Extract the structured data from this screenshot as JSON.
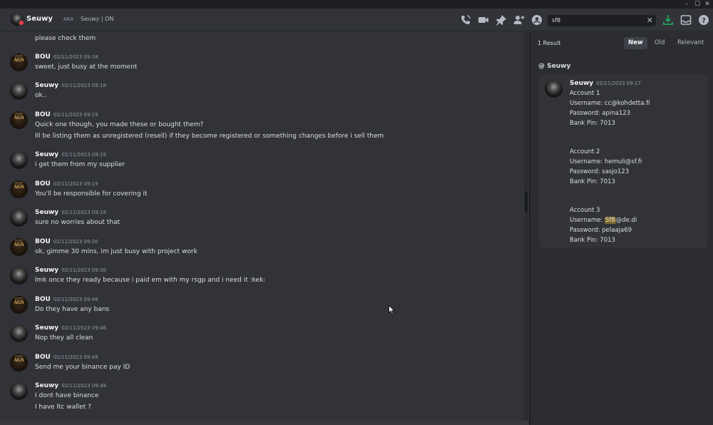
{
  "window": {
    "controls": [
      "–",
      "☐",
      "✕"
    ]
  },
  "header": {
    "name": "Seuwy",
    "aka_label": "AKA",
    "aka_value": "Seuwy | ON",
    "icons": [
      "phone-icon",
      "video-icon",
      "pin-icon",
      "add-friend-icon",
      "profile-icon",
      "download-icon",
      "inbox-icon",
      "help-icon"
    ],
    "search": {
      "value": "sf8",
      "placeholder": "Search"
    }
  },
  "chat": {
    "partial_top_line": "please check them",
    "messages": [
      {
        "author": "BOU",
        "time": "02/11/2023 09:18",
        "lines": [
          "sweet, just busy at the moment"
        ]
      },
      {
        "author": "Seuwy",
        "time": "02/11/2023 09:18",
        "lines": [
          "ok.."
        ]
      },
      {
        "author": "BOU",
        "time": "02/11/2023 09:19",
        "lines": [
          "Quick one though, you made these or bought them?",
          "Ill be listing them as unregistered (resell) if they become registered or something changes before i sell them"
        ]
      },
      {
        "author": "Seuwy",
        "time": "02/11/2023 09:19",
        "lines": [
          "i get them from my supplier"
        ]
      },
      {
        "author": "BOU",
        "time": "02/11/2023 09:19",
        "lines": [
          "You'll be responsible for covering it"
        ]
      },
      {
        "author": "Seuwy",
        "time": "02/11/2023 09:19",
        "lines": [
          "sure no worries about that"
        ]
      },
      {
        "author": "BOU",
        "time": "02/11/2023 09:20",
        "lines": [
          "ok, gimme 30 mins, im just busy with project work"
        ]
      },
      {
        "author": "Seuwy",
        "time": "02/11/2023 09:30",
        "lines": [
          "lmk once they ready because i paid em with my rsgp and i need it :kek:"
        ]
      },
      {
        "author": "BOU",
        "time": "02/11/2023 09:46",
        "lines": [
          "Do they have any bans"
        ]
      },
      {
        "author": "Seuwy",
        "time": "02/11/2023 09:46",
        "lines": [
          "Nop they all clean"
        ]
      },
      {
        "author": "BOU",
        "time": "02/11/2023 09:49",
        "lines": [
          "Send me your binance pay ID"
        ]
      },
      {
        "author": "Seuwy",
        "time": "02/11/2023 09:49",
        "lines": [
          "I dont have binance",
          "I have ltc wallet ?"
        ]
      }
    ]
  },
  "results": {
    "count": "1 Result",
    "tabs": [
      "New",
      "Old",
      "Relevant"
    ],
    "active_tab": "New",
    "channel": "@ Seuwy",
    "result": {
      "author": "Seuwy",
      "time": "02/11/2023 09:17",
      "account1": [
        "Account 1",
        "Username: cc@kohdetta.fi",
        "Password: apina123",
        "Bank Pin: 7013"
      ],
      "account2": [
        "Account 2",
        "Username: hemuli@sf.fi",
        "Password: sasjo123",
        "Bank Pin: 7013"
      ],
      "account3_title": "Account 3",
      "account3_user_prefix": "Username: ",
      "account3_user_highlight": "Sf8",
      "account3_user_suffix": "@de.di",
      "account3_rest": [
        "Password: pelaaja69",
        "Bank Pin: 7013"
      ]
    }
  },
  "colors": {
    "background": "#313338",
    "panel": "#2b2d31",
    "highlight": "#7a6636",
    "status_dnd": "#f23f43",
    "download_green": "#23a55a"
  }
}
